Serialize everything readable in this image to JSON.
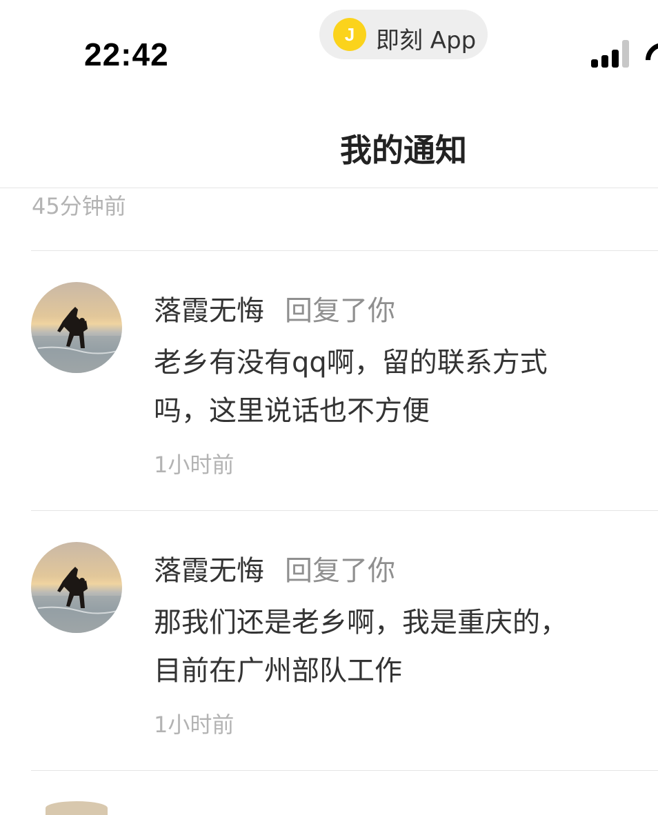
{
  "status_bar": {
    "time": "22:42",
    "app_badge": {
      "icon": "jike-app-logo",
      "label": "即刻 App",
      "color": "#fbd31c"
    }
  },
  "nav": {
    "title": "我的通知"
  },
  "previous_item": {
    "time": "45分钟前"
  },
  "notifications": [
    {
      "author": "落霞无悔",
      "action": "回复了你",
      "body_line1": "老乡有没有qq啊，留的联系方式",
      "body_line2": "吗，这里说话也不方便",
      "time": "1小时前"
    },
    {
      "author": "落霞无悔",
      "action": "回复了你",
      "body_line1": "那我们还是老乡啊，我是重庆的，",
      "body_line2": "目前在广州部队工作",
      "time": "1小时前"
    }
  ],
  "colors": {
    "accent": "#fbd31c",
    "primary_text": "#333333",
    "secondary_text": "#8f8f8f",
    "muted_text": "#b3b3b3",
    "divider": "#e5e5e5"
  }
}
